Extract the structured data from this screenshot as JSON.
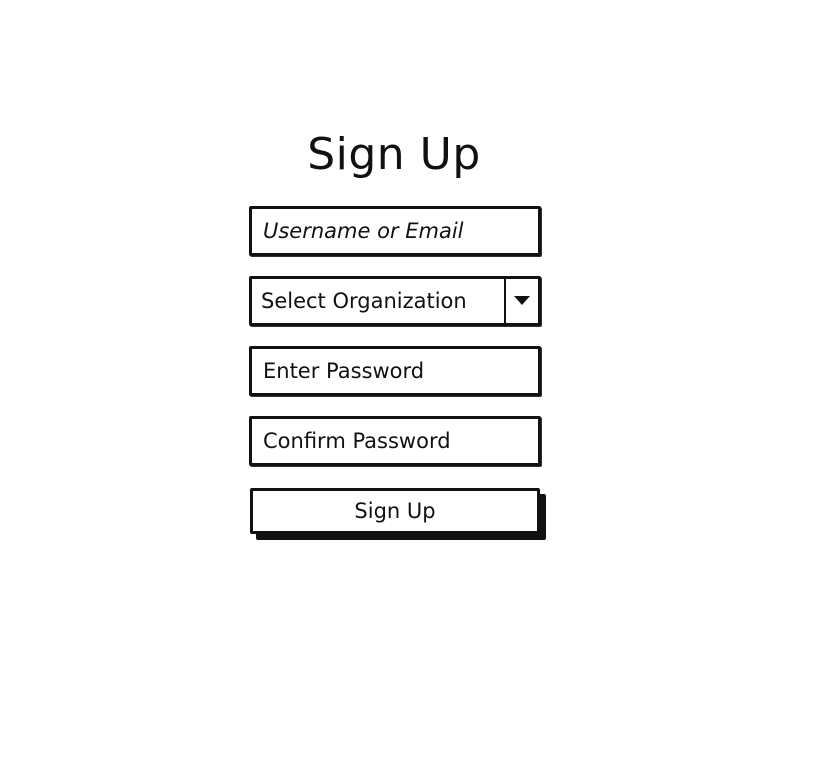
{
  "form": {
    "title": "Sign Up",
    "username": {
      "placeholder": "Username or Email",
      "value": ""
    },
    "organization": {
      "selected": "Select Organization",
      "arrow_icon": "caret-down-icon"
    },
    "password": {
      "placeholder": "Enter Password",
      "value": ""
    },
    "confirm_password": {
      "placeholder": "Confirm Password",
      "value": ""
    },
    "submit_label": "Sign Up"
  }
}
